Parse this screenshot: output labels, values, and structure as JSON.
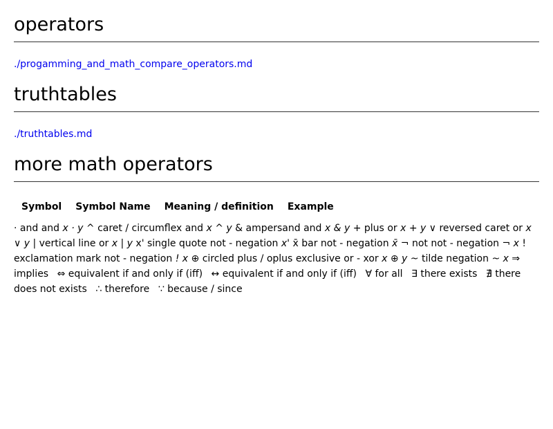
{
  "sections": [
    {
      "heading": "operators",
      "link": "./progamming_and_math_compare_operators.md"
    },
    {
      "heading": "truthtables",
      "link": "./truthtables.md"
    },
    {
      "heading": "more math operators"
    }
  ],
  "table": {
    "headers": [
      "Symbol",
      "Symbol Name",
      "Meaning / definition",
      "Example"
    ],
    "rows": [
      {
        "symbol": "·",
        "name": "and",
        "meaning": "and",
        "example": "x · y"
      },
      {
        "symbol": "^",
        "name": "caret / circumflex",
        "meaning": "and",
        "example": "x ^ y"
      },
      {
        "symbol": "&",
        "name": "ampersand",
        "meaning": "and",
        "example": "x & y"
      },
      {
        "symbol": "+",
        "name": "plus",
        "meaning": "or",
        "example": "x + y"
      },
      {
        "symbol": "∨",
        "name": "reversed caret",
        "meaning": "or",
        "example": "x ∨ y"
      },
      {
        "symbol": "|",
        "name": "vertical line",
        "meaning": "or",
        "example": "x | y"
      },
      {
        "symbol": "x'",
        "name": "single quote",
        "meaning": "not - negation",
        "example": "x'"
      },
      {
        "symbol": "x̄",
        "name": "bar",
        "meaning": "not - negation",
        "example": "x̄"
      },
      {
        "symbol": "¬",
        "name": "not",
        "meaning": "not - negation",
        "example": "¬ x"
      },
      {
        "symbol": "!",
        "name": "exclamation mark",
        "meaning": "not - negation",
        "example": "! x"
      },
      {
        "symbol": "⊕",
        "name": "circled plus / oplus",
        "meaning": "exclusive or - xor",
        "example": "x ⊕ y"
      },
      {
        "symbol": "~",
        "name": "tilde",
        "meaning": "negation",
        "example": "~ x"
      },
      {
        "symbol": "⇒",
        "name": "implies",
        "meaning": "",
        "example": ""
      },
      {
        "symbol": "⇔",
        "name": "equivalent",
        "meaning": "if and only if (iff)",
        "example": ""
      },
      {
        "symbol": "↔",
        "name": "equivalent",
        "meaning": "if and only if (iff)",
        "example": ""
      },
      {
        "symbol": "∀",
        "name": "for all",
        "meaning": "",
        "example": ""
      },
      {
        "symbol": "∃",
        "name": "there exists",
        "meaning": "",
        "example": ""
      },
      {
        "symbol": "∄",
        "name": "there does not exists",
        "meaning": "",
        "example": ""
      },
      {
        "symbol": "∴",
        "name": "therefore",
        "meaning": "",
        "example": ""
      },
      {
        "symbol": "∵",
        "name": "because / since",
        "meaning": "",
        "example": ""
      }
    ]
  }
}
